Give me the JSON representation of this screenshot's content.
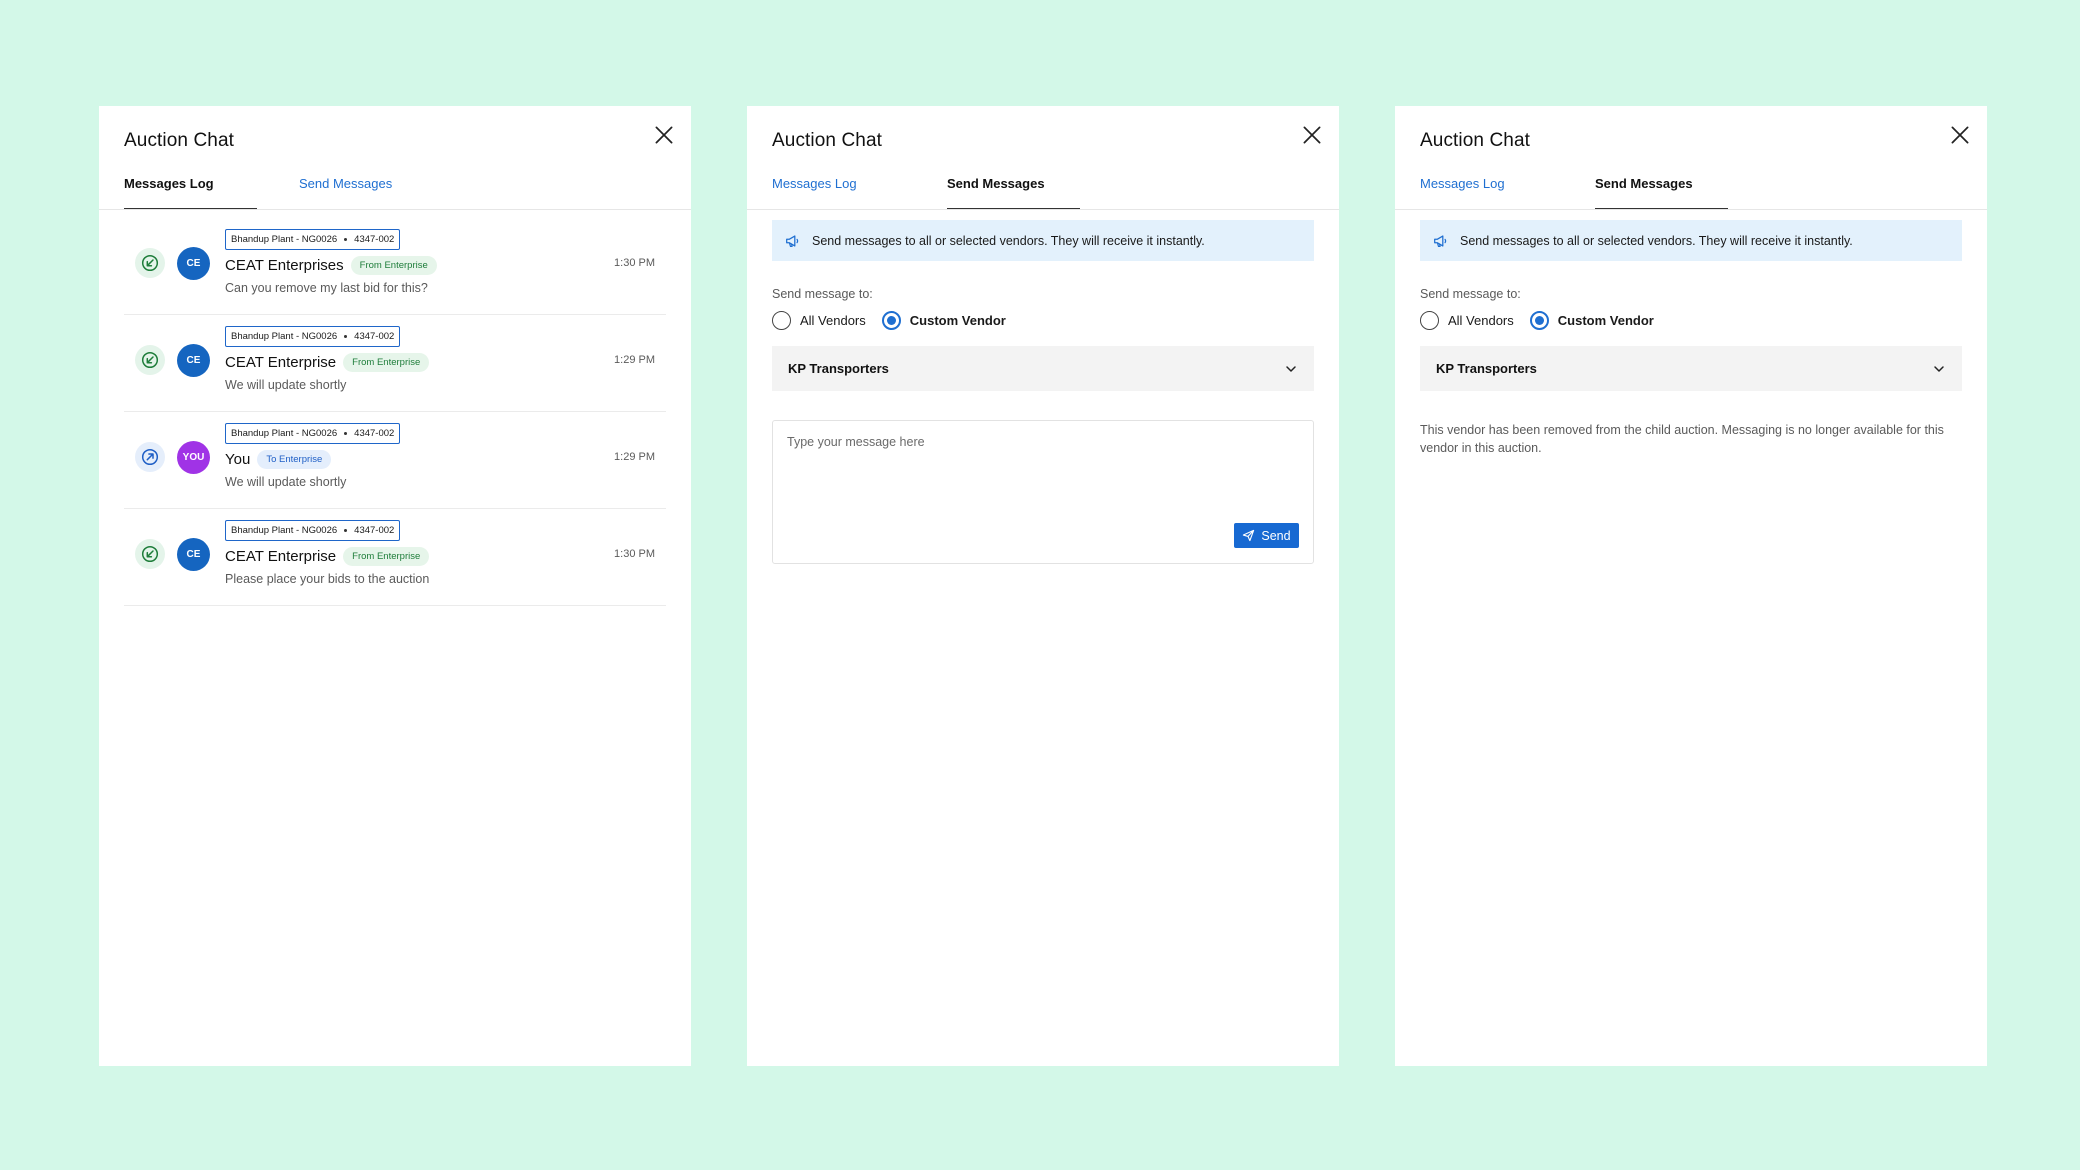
{
  "colors": {
    "background": "#d3f8e8",
    "accent": "#1f6fd1",
    "avatar_ce": "#1565c0",
    "avatar_you": "#a033e6",
    "from_badge": "#1e7d3a",
    "info_banner": "#e3f1fc"
  },
  "panel1": {
    "title": "Auction Chat",
    "close_icon": "close-icon",
    "tabs": [
      "Messages Log",
      "Send Messages"
    ],
    "active_tab": "Messages Log",
    "messages": [
      {
        "direction_icon": "incoming-arrow-icon",
        "avatar": "CE",
        "plant": "Bhandup Plant - NG0026",
        "ref": "4347-002",
        "sender": "CEAT Enterprises",
        "badge": "From Enterprise",
        "text": "Can you remove my last bid for this?",
        "time": "1:30 PM"
      },
      {
        "direction_icon": "incoming-arrow-icon",
        "avatar": "CE",
        "plant": "Bhandup Plant - NG0026",
        "ref": "4347-002",
        "sender": "CEAT Enterprise",
        "badge": "From Enterprise",
        "text": "We will update shortly",
        "time": "1:29 PM"
      },
      {
        "direction_icon": "outgoing-arrow-icon",
        "avatar": "YOU",
        "plant": "Bhandup Plant - NG0026",
        "ref": "4347-002",
        "sender": "You",
        "badge": "To Enterprise",
        "text": "We will update shortly",
        "time": "1:29 PM"
      },
      {
        "direction_icon": "incoming-arrow-icon",
        "avatar": "CE",
        "plant": "Bhandup Plant - NG0026",
        "ref": "4347-002",
        "sender": "CEAT Enterprise",
        "badge": "From Enterprise",
        "text": "Please place your bids to the auction",
        "time": "1:30 PM"
      }
    ]
  },
  "panel2": {
    "title": "Auction Chat",
    "tabs": [
      "Messages Log",
      "Send Messages"
    ],
    "active_tab": "Send Messages",
    "banner": "Send messages to all or selected vendors. They will receive it instantly.",
    "send_to_label": "Send message to:",
    "radio_all": "All Vendors",
    "radio_custom": "Custom Vendor",
    "selected_radio": "Custom Vendor",
    "vendor_selected": "KP Transporters",
    "message_placeholder": "Type your message here",
    "message_value": "",
    "send_label": "Send"
  },
  "panel3": {
    "title": "Auction Chat",
    "tabs": [
      "Messages Log",
      "Send Messages"
    ],
    "active_tab": "Send Messages",
    "banner": "Send messages to all or selected vendors. They will receive it instantly.",
    "send_to_label": "Send message to:",
    "radio_all": "All Vendors",
    "radio_custom": "Custom Vendor",
    "selected_radio": "Custom Vendor",
    "vendor_selected": "KP Transporters",
    "removed_note": "This vendor has been removed from the child auction. Messaging is no longer available for this vendor in this auction."
  }
}
